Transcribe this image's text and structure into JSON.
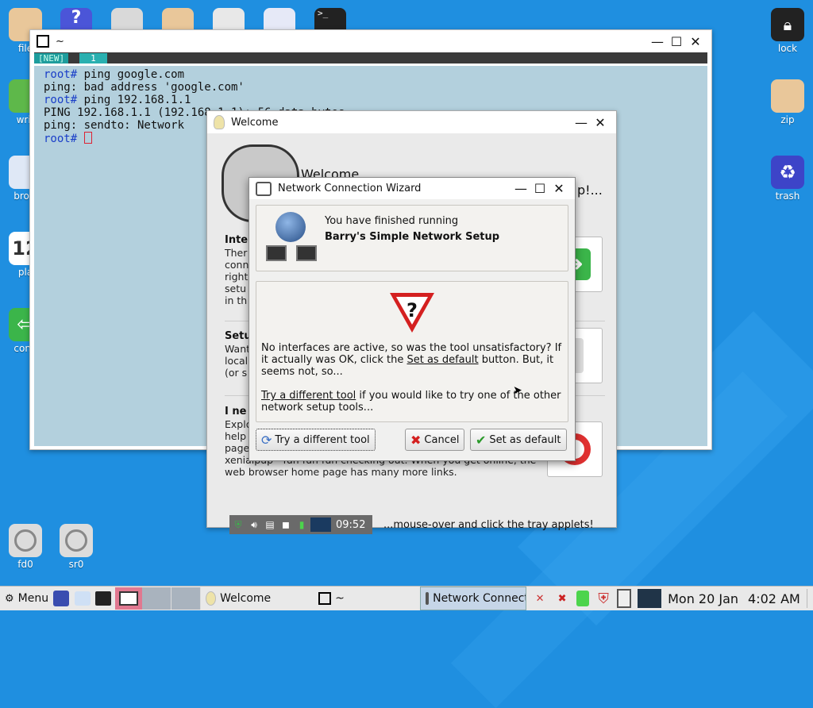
{
  "desktop": {
    "left_icons": [
      {
        "label": "file"
      },
      {
        "label": "writ"
      },
      {
        "label": "brow"
      },
      {
        "label": "pla",
        "calendar_text": "12"
      },
      {
        "label": "conn"
      }
    ],
    "right_icons": [
      {
        "label": "lock"
      },
      {
        "label": "zip"
      },
      {
        "label": "trash"
      }
    ],
    "drive_icons": [
      {
        "label": "fd0"
      },
      {
        "label": "sr0"
      }
    ],
    "background_color": "#1f8fe0"
  },
  "terminal": {
    "title": "~",
    "tab_new": "[NEW]",
    "tab_num": "1",
    "lines": [
      {
        "prompt": "root#",
        "text": " ping google.com"
      },
      {
        "prompt": "",
        "text": "ping: bad address 'google.com'"
      },
      {
        "prompt": "root#",
        "text": " ping 192.168.1.1"
      },
      {
        "prompt": "",
        "text": "PING 192.168.1.1 (192.168.1.1): 56 data bytes"
      },
      {
        "prompt": "",
        "text": "ping: sendto: Network"
      },
      {
        "prompt": "root#",
        "text": " "
      }
    ]
  },
  "welcome": {
    "title": "Welcome",
    "heading": "Welcome",
    "heading_right": "p!...",
    "sections": [
      {
        "heading": "Inte",
        "text": "Ther\nconn\nright\nsetu\nin th"
      },
      {
        "heading": "Setu",
        "text": "Want\nlocal\n(or s"
      },
      {
        "heading": "I ne",
        "text": "Explo\nhelp\npage\nxenialpup - fun fun fun checking out. When you get online, the\nweb browser home page has many more links."
      }
    ],
    "tray_time": "09:52",
    "tray_hint": "...mouse-over and click the tray applets!"
  },
  "wizard": {
    "title": "Network Connection Wizard",
    "finished_line1": "You have finished running",
    "finished_line2": "Barry's Simple Network Setup",
    "msg_pre": "No interfaces are active, so was the tool unsatisfactory? If it actually was OK, click the ",
    "msg_link": "Set as default",
    "msg_post": " button. But, it seems not, so...",
    "try_link": "Try a different tool",
    "try_post": " if you would like to try one of the other network setup tools...",
    "btn_try": "Try a different tool",
    "btn_cancel": "Cancel",
    "btn_default": "Set as default"
  },
  "taskbar": {
    "menu_label": "Menu",
    "windows": [
      {
        "label": "Welcome"
      },
      {
        "label": "~"
      },
      {
        "label": "Network Connect"
      }
    ],
    "date": "Mon 20 Jan",
    "time": "4:02 AM"
  }
}
